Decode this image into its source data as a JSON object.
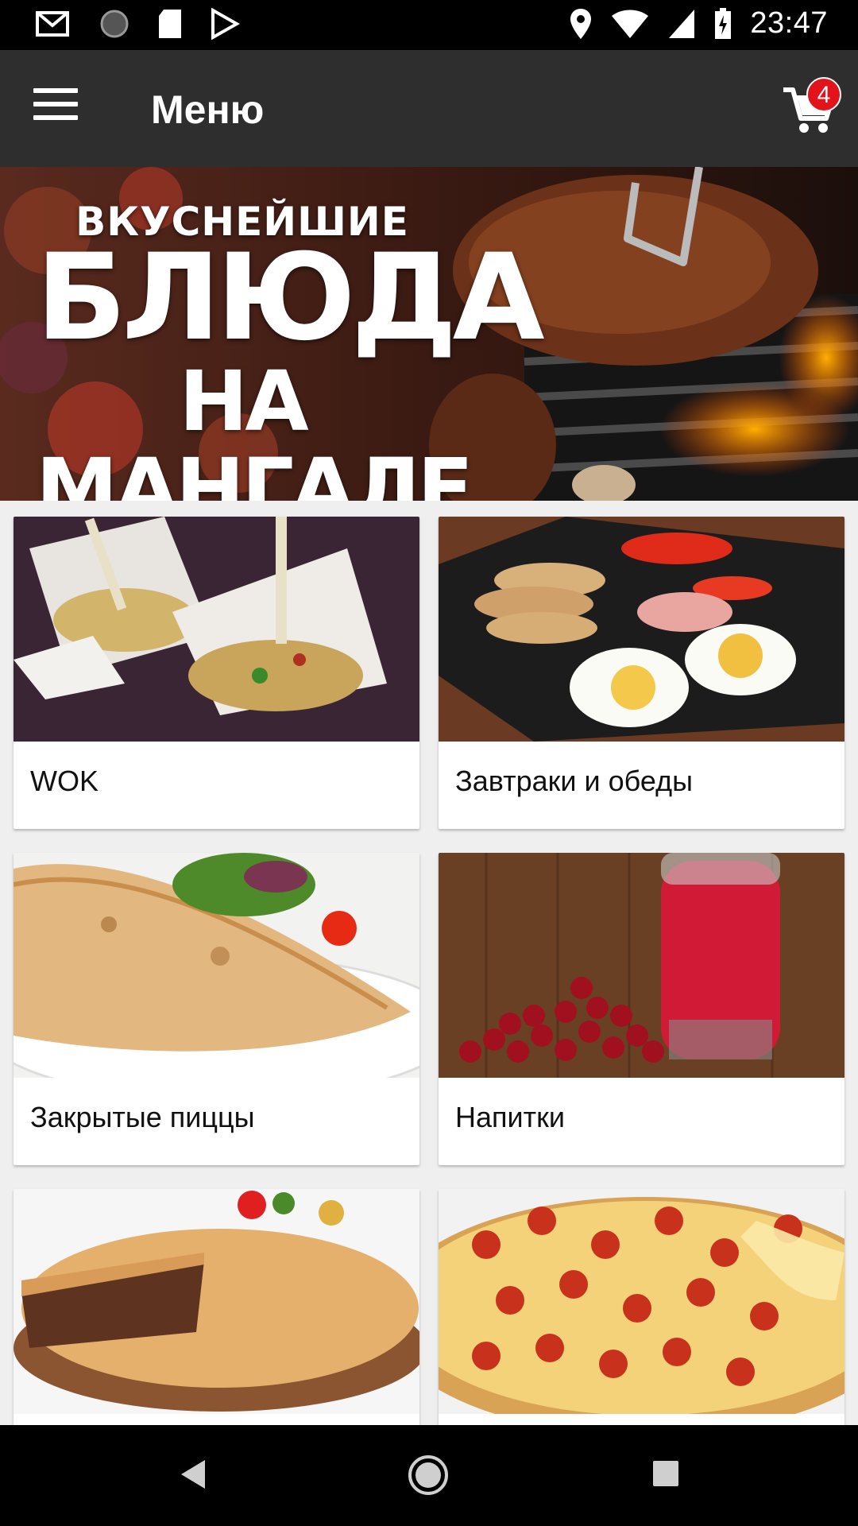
{
  "status_bar": {
    "time": "23:47",
    "icons": [
      "gmail-icon",
      "sync-icon",
      "sd-card-icon",
      "play-store-icon",
      "location-icon",
      "wifi-icon",
      "signal-icon",
      "battery-charging-icon"
    ]
  },
  "app_bar": {
    "title": "Меню",
    "cart_count": "4"
  },
  "banner": {
    "line1": "ВКУСНЕЙШИЕ",
    "line2": "БЛЮДА",
    "line3": "НА МАНГАЛЕ"
  },
  "categories": [
    {
      "label": "WOK"
    },
    {
      "label": "Завтраки и обеды"
    },
    {
      "label": "Закрытые пиццы"
    },
    {
      "label": "Напитки"
    },
    {
      "label": ""
    },
    {
      "label": ""
    }
  ],
  "colors": {
    "app_bar": "#2e2e2e",
    "badge": "#e3131b",
    "background": "#efefef"
  }
}
